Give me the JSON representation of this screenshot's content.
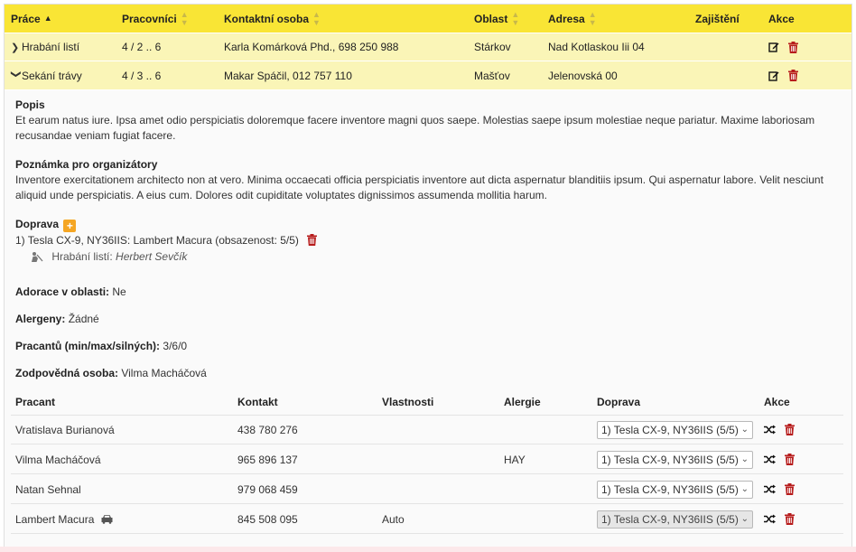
{
  "table": {
    "headers": {
      "prace": "Práce",
      "pracovnici": "Pracovníci",
      "kontakt": "Kontaktní osoba",
      "oblast": "Oblast",
      "adresa": "Adresa",
      "zajisteni": "Zajištění",
      "akce": "Akce"
    },
    "rows": [
      {
        "prace": "Hrabání listí",
        "pracovnici": "4 / 2 .. 6",
        "kontakt": "Karla Komárková Phd., 698 250 988",
        "oblast": "Stárkov",
        "adresa": "Nad Kotlaskou Iii 04",
        "zajisteni": ""
      },
      {
        "prace": "Sekání trávy",
        "pracovnici": "4 / 3 .. 6",
        "kontakt": "Makar Spáčil, 012 757 110",
        "oblast": "Mašťov",
        "adresa": "Jelenovská 00",
        "zajisteni": ""
      }
    ]
  },
  "detail": {
    "popis_label": "Popis",
    "popis_text": "Et earum natus iure. Ipsa amet odio perspiciatis doloremque facere inventore magni quos saepe. Molestias saepe ipsum molestiae neque pariatur. Maxime laboriosam recusandae veniam fugiat facere.",
    "poznamka_label": "Poznámka pro organizátory",
    "poznamka_text": "Inventore exercitationem architecto non at vero. Minima occaecati officia perspiciatis inventore aut dicta aspernatur blanditiis ipsum. Qui aspernatur labore. Velit nesciunt aliquid unde perspiciatis. A eius cum. Dolores odit cupiditate voluptates dignissimos assumenda mollitia harum.",
    "doprava_label": "Doprava",
    "doprava_add": "+",
    "car_line": "1) Tesla CX-9, NY36IIS: Lambert Macura (obsazenost: 5/5)",
    "car_job": "Hrabání listí:",
    "car_person": "Herbert Sevčík",
    "adorace_label": "Adorace v oblasti:",
    "adorace_value": "Ne",
    "alergeny_label": "Alergeny:",
    "alergeny_value": "Žádné",
    "pracantu_label": "Pracantů (min/max/silných):",
    "pracantu_value": "3/6/0",
    "zodp_label": "Zodpovědná osoba:",
    "zodp_value": "Vilma Macháčová"
  },
  "workers": {
    "headers": {
      "pracant": "Pracant",
      "kontakt": "Kontakt",
      "vlastnosti": "Vlastnosti",
      "alergie": "Alergie",
      "doprava": "Doprava",
      "akce": "Akce"
    },
    "rows": [
      {
        "name": "Vratislava Burianová",
        "contact": "438 780 276",
        "traits": "",
        "allergy": "",
        "transport": "1) Tesla CX-9, NY36IIS (5/5)"
      },
      {
        "name": "Vilma Macháčová",
        "contact": "965 896 137",
        "traits": "",
        "allergy": "HAY",
        "transport": "1) Tesla CX-9, NY36IIS (5/5)"
      },
      {
        "name": "Natan Sehnal",
        "contact": "979 068 459",
        "traits": "",
        "allergy": "",
        "transport": "1) Tesla CX-9, NY36IIS (5/5)"
      },
      {
        "name": "Lambert Macura",
        "contact": "845 508 095",
        "traits": "Auto",
        "allergy": "",
        "transport": "1) Tesla CX-9, NY36IIS (5/5)"
      }
    ]
  },
  "colors": {
    "header_bg": "#f9e535",
    "row_bg": "#faf5b7",
    "delete_red": "#b71c1c",
    "add_orange": "#f5a623"
  }
}
